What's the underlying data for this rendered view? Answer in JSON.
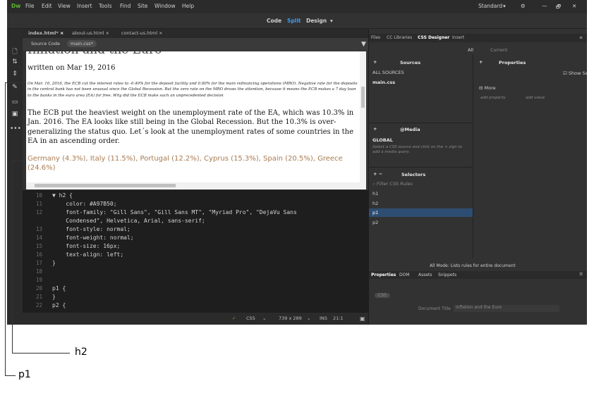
{
  "app": {
    "logo": "Dw",
    "menus": [
      "File",
      "Edit",
      "View",
      "Insert",
      "Tools",
      "Find",
      "Site",
      "Window",
      "Help"
    ],
    "workspace": "Standard",
    "workspace_arrow": "▾",
    "gear": "⚙",
    "win_controls": [
      "—",
      "🗗",
      "✕"
    ]
  },
  "views": {
    "code": "Code",
    "split": "Split",
    "design": "Design"
  },
  "doc_tabs": [
    "index.html*",
    "about-us.html",
    "contact-us.html"
  ],
  "related_files": {
    "source": "Source Code",
    "css": "main.css*"
  },
  "live": {
    "h1_partial": "Inflation and the Euro",
    "written": "written on Mar 19, 2016",
    "p1": "On Mar. 10, 2016, the ECB cut the interest rates to -0.40% for the deposit facility and 0.00% for the main refinancing operations (MRO). Negative rate for the deposits in the central bank has not been unusual since the Global Recession. But the zero rate on the MRO draws the attention, because it means the ECB makes a 7 day loan to the banks in the euro area (EA) for free. Why did the ECB make such an unprecedented decision",
    "para": "The ECB put the heaviest weight on the unemployment rate of the EA, which was 10.3% in Jan. 2016. The EA looks like still being in the Global Recession. But the 10.3% is over-generalizing the status quo. Let´s look at the unemployment rates of some countries in the EA in an ascending order.",
    "h2": "Germany (4.3%), Italy (11.5%), Portugal (12.2%), Cyprus (15.3%), Spain (20.5%), Greece (24.6%)",
    "h2_color": "#A97B50"
  },
  "code_lines": [
    {
      "n": "10",
      "t": "▼ h2 {"
    },
    {
      "n": "11",
      "t": "    color: #A97B50;"
    },
    {
      "n": "12",
      "t": "    font-family: \"Gill Sans\", \"Gill Sans MT\", \"Myriad Pro\", \"DejaVu Sans"
    },
    {
      "n": "",
      "t": "    Condensed\", Helvetica, Arial, sans-serif;"
    },
    {
      "n": "13",
      "t": "    font-style: normal;"
    },
    {
      "n": "14",
      "t": "    font-weight: normal;"
    },
    {
      "n": "15",
      "t": "    font-size: 16px;"
    },
    {
      "n": "16",
      "t": "    text-align: left;"
    },
    {
      "n": "17",
      "t": "}"
    },
    {
      "n": "18",
      "t": ""
    },
    {
      "n": "19",
      "t": ""
    },
    {
      "n": "20",
      "t": "p1 {"
    },
    {
      "n": "21",
      "t": "}"
    },
    {
      "n": "22",
      "t": "p2 {"
    }
  ],
  "status": {
    "lang": "CSS",
    "size": "739 x 289",
    "mode": "INS",
    "pos": "21:1"
  },
  "panel": {
    "tabs": [
      "Files",
      "CC Libraries",
      "CSS Designer",
      "Insert"
    ],
    "toggle": [
      "All",
      "Current"
    ],
    "sources": {
      "title": "Sources",
      "items": [
        "ALL SOURCES",
        "main.css"
      ]
    },
    "media": {
      "title": "@Media",
      "global": "GLOBAL",
      "hint": "Select a CSS source and click on the + sign to add a media query."
    },
    "selectors": {
      "title": "Selectors",
      "filter": "Filter CSS Rules",
      "items": [
        "h1",
        "h2",
        "p1",
        "p2"
      ],
      "selected": "p1"
    },
    "properties": {
      "title": "Properties",
      "show_set": "Show Set",
      "more": "More",
      "add_property": "add property",
      "add_value": "add value"
    },
    "footer": "All Mode: Lists rules for entire document"
  },
  "bottom_tabs": [
    "Properties",
    "DOM",
    "Assets",
    "Snippets"
  ],
  "bottom_props": {
    "css_btn": "CSS",
    "title_label": "Document Title",
    "title_value": "Inflation and the Euro"
  },
  "annotations": {
    "h2": "h2",
    "p1": "p1"
  }
}
